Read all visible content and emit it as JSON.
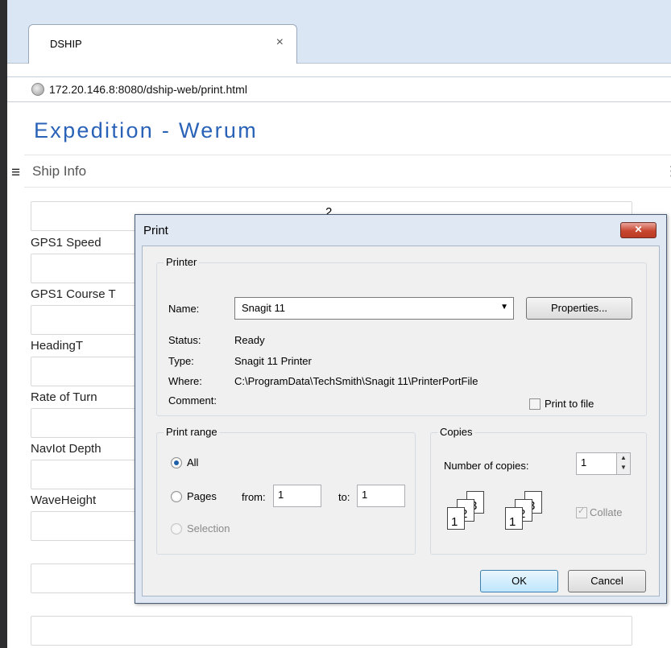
{
  "browser": {
    "tab_title": "DSHIP",
    "tab_close": "×",
    "url": "172.20.146.8:8080/dship-web/print.html"
  },
  "page": {
    "title": "Expedition - Werum",
    "nav_label": "Ship Info",
    "menu_icon": "≡",
    "right_mark": "⋮",
    "top_field_fragment": "2",
    "fields": [
      {
        "label": "GPS1 Speed"
      },
      {
        "label": "GPS1 Course T"
      },
      {
        "label": "HeadingT"
      },
      {
        "label": "Rate of Turn"
      },
      {
        "label": "NavIot Depth"
      },
      {
        "label": "WaveHeight"
      }
    ]
  },
  "dialog": {
    "title": "Print",
    "close": "✕",
    "printer": {
      "group_title": "Printer",
      "name_label": "Name:",
      "name_value": "Snagit 11",
      "properties_button": "Properties...",
      "status_label": "Status:",
      "status_value": "Ready",
      "type_label": "Type:",
      "type_value": "Snagit 11 Printer",
      "where_label": "Where:",
      "where_value": "C:\\ProgramData\\TechSmith\\Snagit 11\\PrinterPortFile",
      "comment_label": "Comment:",
      "print_to_file": "Print to file"
    },
    "range": {
      "group_title": "Print range",
      "all": "All",
      "pages": "Pages",
      "from_label": "from:",
      "from_value": "1",
      "to_label": "to:",
      "to_value": "1",
      "selection": "Selection"
    },
    "copies": {
      "group_title": "Copies",
      "number_label": "Number of copies:",
      "number_value": "1",
      "collate": "Collate",
      "page_numbers": [
        "1",
        "2",
        "3"
      ]
    },
    "ok_button": "OK",
    "cancel_button": "Cancel"
  },
  "colors": {
    "title_blue": "#2a62b8",
    "dialog_frame": "#dfe8f3",
    "close_red": "#c8462f"
  }
}
